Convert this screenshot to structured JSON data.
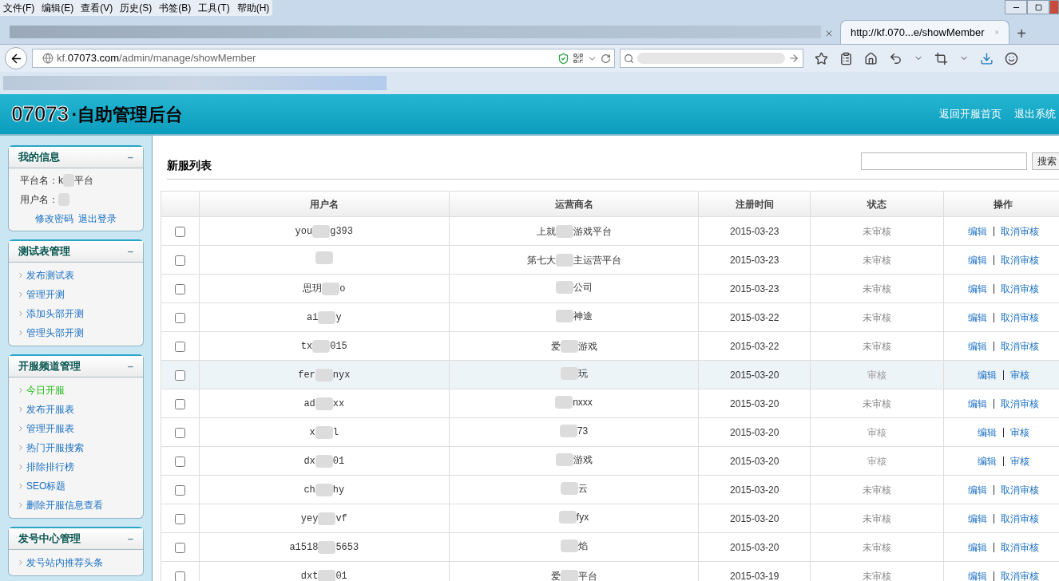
{
  "menu_bar": [
    "文件(F)",
    "编辑(E)",
    "查看(V)",
    "历史(S)",
    "书签(B)",
    "工具(T)",
    "帮助(H)"
  ],
  "tabs": [
    {
      "selected": false
    },
    {
      "title": "http://kf.070...e/showMember",
      "selected": true
    }
  ],
  "new_tab": "+",
  "address": {
    "prefix": "kf.",
    "domain": "07073.com",
    "path": "/admin/manage/showMember"
  },
  "header": {
    "logo": "07073",
    "title": "·自助管理后台",
    "links": [
      "返回开服首页",
      "退出系统"
    ]
  },
  "sidebar": {
    "info": {
      "title": "我的信息",
      "collapse": "–",
      "fields": [
        {
          "label": "平台名：",
          "before": "k",
          "after": "平台"
        },
        {
          "label": "用户名："
        }
      ],
      "links": [
        "修改密码",
        "退出登录"
      ]
    },
    "sections": [
      {
        "title": "测试表管理",
        "collapse": "–",
        "items": [
          {
            "label": "发布测试表",
            "selected": false
          },
          {
            "label": "管理开测",
            "selected": false
          },
          {
            "label": "添加头部开测",
            "selected": false
          },
          {
            "label": "管理头部开测",
            "selected": false
          }
        ]
      },
      {
        "title": "开服频道管理",
        "collapse": "–",
        "items": [
          {
            "label": "今日开服",
            "selected": true
          },
          {
            "label": "发布开服表",
            "selected": false
          },
          {
            "label": "管理开服表",
            "selected": false
          },
          {
            "label": "热门开服搜索",
            "selected": false
          },
          {
            "label": "排除排行榜",
            "selected": false
          },
          {
            "label": "SEO标题",
            "selected": false
          },
          {
            "label": "删除开服信息查看",
            "selected": false
          }
        ]
      },
      {
        "title": "发号中心管理",
        "collapse": "–",
        "items": [
          {
            "label": "发号站内推荐头条",
            "selected": false
          }
        ]
      }
    ]
  },
  "page_title": "新服列表",
  "search_button": "搜索",
  "table": {
    "columns": [
      "用户名",
      "运营商名",
      "注册时间",
      "状态",
      "操作"
    ],
    "rows": [
      {
        "checked": false,
        "highlighted": false,
        "user": {
          "before": "you",
          "after": "g393"
        },
        "operator": {
          "before": "上就",
          "after": "游戏平台"
        },
        "date": "2015-03-23",
        "reviewed": false,
        "status": "未审核",
        "actions": [
          "编辑",
          "取消审核"
        ]
      },
      {
        "checked": false,
        "highlighted": false,
        "user": {},
        "operator": {
          "before": "第七大",
          "after": "主运营平台"
        },
        "date": "2015-03-23",
        "reviewed": false,
        "status": "未审核",
        "actions": [
          "编辑",
          "取消审核"
        ]
      },
      {
        "checked": false,
        "highlighted": false,
        "user": {
          "before": "思玥",
          "after": "o"
        },
        "operator": {
          "after": "公司"
        },
        "date": "2015-03-23",
        "reviewed": false,
        "status": "未审核",
        "actions": [
          "编辑",
          "取消审核"
        ]
      },
      {
        "checked": false,
        "highlighted": false,
        "user": {
          "before": "ai",
          "after": "y"
        },
        "operator": {
          "after": "神途"
        },
        "date": "2015-03-22",
        "reviewed": false,
        "status": "未审核",
        "actions": [
          "编辑",
          "取消审核"
        ]
      },
      {
        "checked": false,
        "highlighted": false,
        "user": {
          "before": "tx",
          "after": "015"
        },
        "operator": {
          "before": "爱",
          "after": "游戏"
        },
        "date": "2015-03-22",
        "reviewed": false,
        "status": "未审核",
        "actions": [
          "编辑",
          "取消审核"
        ]
      },
      {
        "checked": false,
        "highlighted": true,
        "user": {
          "before": "fer",
          "after": "nyx"
        },
        "operator": {
          "after": "玩"
        },
        "date": "2015-03-20",
        "reviewed": true,
        "status": "审核",
        "actions": [
          "编辑",
          "审核"
        ]
      },
      {
        "checked": false,
        "highlighted": false,
        "user": {
          "before": "ad",
          "after": "xx"
        },
        "operator": {
          "after": "nxxx"
        },
        "date": "2015-03-20",
        "reviewed": false,
        "status": "未审核",
        "actions": [
          "编辑",
          "取消审核"
        ]
      },
      {
        "checked": false,
        "highlighted": false,
        "user": {
          "before": "x",
          "after": "l"
        },
        "operator": {
          "after": "73"
        },
        "date": "2015-03-20",
        "reviewed": true,
        "status": "审核",
        "actions": [
          "编辑",
          "审核"
        ]
      },
      {
        "checked": false,
        "highlighted": false,
        "user": {
          "before": "dx",
          "after": "01"
        },
        "operator": {
          "after": "游戏"
        },
        "date": "2015-03-20",
        "reviewed": true,
        "status": "审核",
        "actions": [
          "编辑",
          "审核"
        ]
      },
      {
        "checked": false,
        "highlighted": false,
        "user": {
          "before": "ch",
          "after": "hy"
        },
        "operator": {
          "after": "云"
        },
        "date": "2015-03-20",
        "reviewed": false,
        "status": "未审核",
        "actions": [
          "编辑",
          "取消审核"
        ]
      },
      {
        "checked": false,
        "highlighted": false,
        "user": {
          "before": "yey",
          "after": "vf"
        },
        "operator": {
          "after": "fyx"
        },
        "date": "2015-03-20",
        "reviewed": false,
        "status": "未审核",
        "actions": [
          "编辑",
          "取消审核"
        ]
      },
      {
        "checked": false,
        "highlighted": false,
        "user": {
          "before": "a1518",
          "after": "5653"
        },
        "operator": {
          "after": "焰"
        },
        "date": "2015-03-20",
        "reviewed": false,
        "status": "未审核",
        "actions": [
          "编辑",
          "取消审核"
        ]
      },
      {
        "checked": false,
        "highlighted": false,
        "user": {
          "before": "dxt",
          "after": "01"
        },
        "operator": {
          "before": "爱",
          "after": "平台"
        },
        "date": "2015-03-19",
        "reviewed": false,
        "status": "未审核",
        "actions": [
          "编辑",
          "取消审核"
        ]
      }
    ]
  }
}
